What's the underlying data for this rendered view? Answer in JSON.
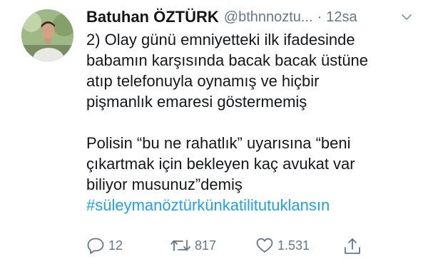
{
  "tweet": {
    "author_name": "Batuhan ÖZTÜRK",
    "handle": "@bthnnoztu...",
    "separator": "·",
    "time": "12sa",
    "lines_p1": [
      "2) Olay günü emniyetteki ilk ifadesinde",
      "babamın karşısında bacak bacak üstüne",
      "atıp telefonuyla oynamış ve hiçbir",
      "pişmanlık emaresi göstermemiş"
    ],
    "lines_p2": [
      "Polisin “bu ne rahatlık” uyarısına “beni",
      "çıkartmak için bekleyen kaç avukat var",
      "biliyor musunuz”demiş"
    ],
    "hashtag": "#süleymanöztürkünkatilitutuklansın"
  },
  "actions": {
    "reply_count": "12",
    "retweet_count": "817",
    "like_count": "1.531"
  },
  "colors": {
    "text": "#14171a",
    "muted": "#657786",
    "link": "#1da1f2"
  },
  "icons": [
    "avatar-photo",
    "chevron-down-icon",
    "reply-icon",
    "retweet-icon",
    "like-icon",
    "share-icon"
  ]
}
